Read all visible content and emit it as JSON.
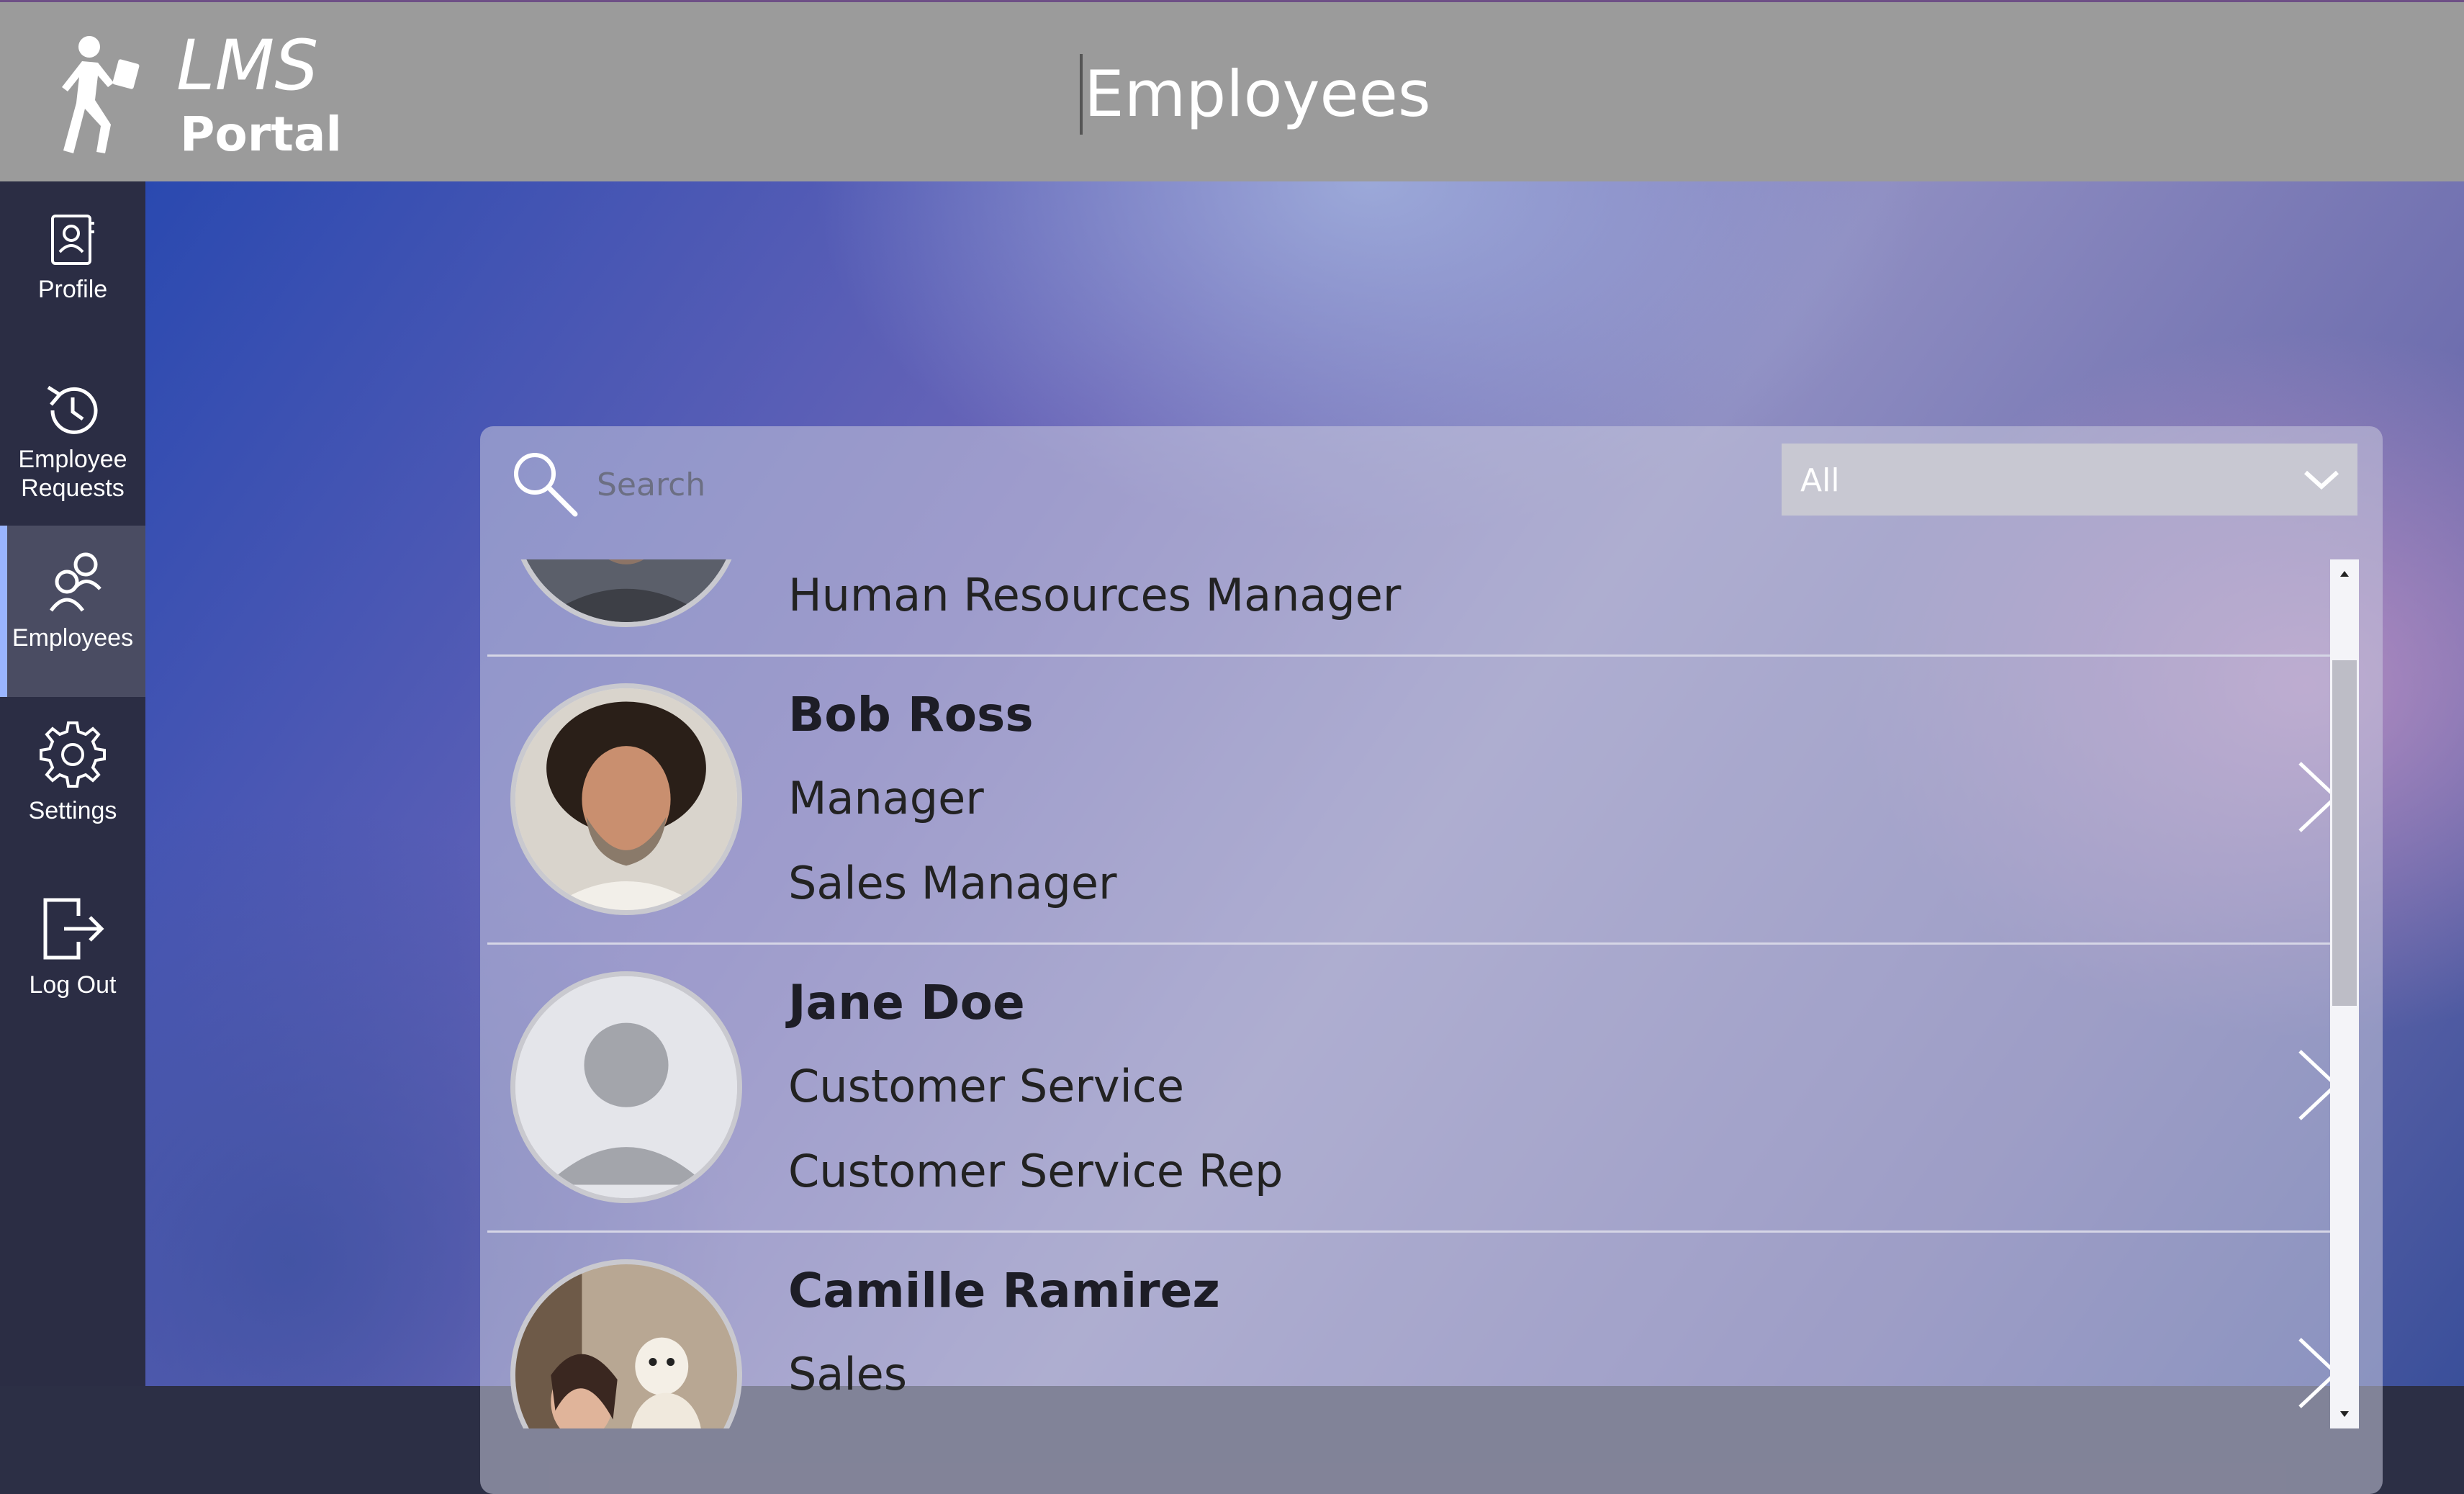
{
  "header": {
    "logo_lms": "LMS",
    "logo_portal": "Portal",
    "page_title": "Employees"
  },
  "sidebar": {
    "items": [
      {
        "label": "Profile",
        "icon": "profile-icon"
      },
      {
        "label": "Employee Requests",
        "icon": "history-icon"
      },
      {
        "label": "Employees",
        "icon": "people-icon",
        "active": true
      },
      {
        "label": "Settings",
        "icon": "gear-icon"
      },
      {
        "label": "Log Out",
        "icon": "logout-icon"
      }
    ]
  },
  "search": {
    "placeholder": "Search",
    "value": ""
  },
  "filter": {
    "selected": "All"
  },
  "employees": [
    {
      "name": "",
      "department": "",
      "title": "Human Resources Manager",
      "avatar": "photo-man-dark"
    },
    {
      "name": "Bob Ross",
      "department": "Manager",
      "title": "Sales Manager",
      "avatar": "photo-bob-ross"
    },
    {
      "name": "Jane Doe",
      "department": "Customer Service",
      "title": "Customer Service Rep",
      "avatar": "placeholder-person"
    },
    {
      "name": "Camille Ramirez",
      "department": "Sales",
      "title": "",
      "avatar": "photo-woman-dog"
    }
  ],
  "colors": {
    "header_bg": "#9b9b9b",
    "sidebar_bg": "#2b2d44",
    "sidebar_active_bg": "#4a4c62",
    "sidebar_active_accent": "#9ab5ff",
    "panel_bg": "rgba(200,200,220,0.55)",
    "divider": "#d6d6e6"
  }
}
